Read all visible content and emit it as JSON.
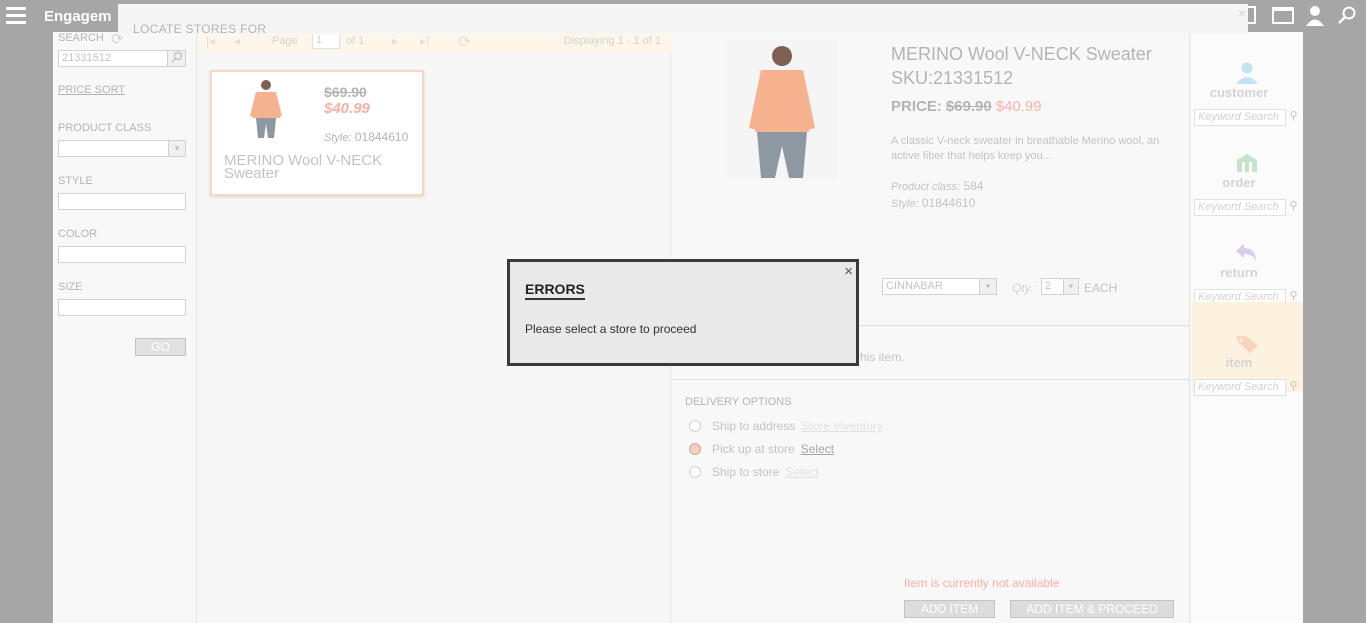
{
  "topbar": {
    "title": "Engagem",
    "icons": [
      "menu-icon",
      "tablet-icon",
      "window-icon",
      "user-icon",
      "search-icon"
    ]
  },
  "locate": {
    "title": "LOCATE STORES FOR",
    "close": "×"
  },
  "filters": {
    "search_label": "SEARCH",
    "search_value": "21331512",
    "price_sort": "PRICE SORT",
    "product_class_label": "PRODUCT CLASS",
    "style_label": "STYLE",
    "color_label": "COLOR",
    "size_label": "SIZE",
    "go": "GO"
  },
  "pager": {
    "page_label": "Page",
    "page_value": "1",
    "of": "of 1",
    "displaying": "Displaying 1 - 1 of 1"
  },
  "card": {
    "old_price": "$69.90",
    "new_price": "$40.99",
    "style_label": "Style:",
    "style_value": "01844610",
    "name": "MERINO Wool V-NECK Sweater"
  },
  "detail": {
    "title": "MERINO Wool V-NECK Sweater",
    "sku": "SKU:21331512",
    "price_label": "PRICE:",
    "old_price": "$69.90",
    "new_price": "$40.99",
    "description": "A classic V-neck sweater in breathable Merino wool, an active fiber that helps keep you...",
    "product_class_label": "Product class:",
    "product_class_value": "584",
    "style_label": "Style:",
    "style_value": "01844610",
    "color_value": "CINNABAR",
    "qty_label": "Qty.:",
    "qty_value": "2",
    "unit": "EACH",
    "partial_text": "his item.",
    "delivery_heading": "DELIVERY OPTIONS",
    "options": [
      {
        "label": "Ship to address",
        "link": "Store Inventory"
      },
      {
        "label": "Pick up at store",
        "link": "Select"
      },
      {
        "label": "Ship to store",
        "link": "Select"
      }
    ],
    "unavailable": "Item is currently not available",
    "add_item": "ADD ITEM",
    "add_item_proceed": "ADD ITEM & PROCEED"
  },
  "rightnav": {
    "items": [
      {
        "label": "customer",
        "placeholder": "Keyword Search"
      },
      {
        "label": "order",
        "placeholder": "Keyword Search"
      },
      {
        "label": "return",
        "placeholder": "Keyword Search"
      },
      {
        "label": "item",
        "placeholder": "Keyword Search"
      }
    ]
  },
  "error_dialog": {
    "title": "ERRORS",
    "message": "Please select a store to proceed",
    "close": "×"
  }
}
